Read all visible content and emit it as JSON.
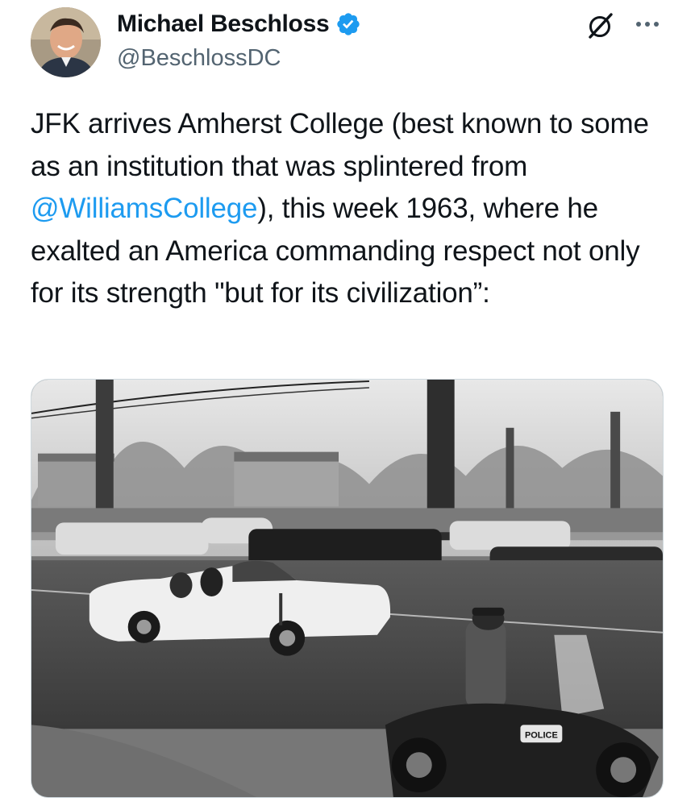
{
  "author": {
    "display_name": "Michael Beschloss",
    "handle": "@BeschlossDC",
    "verified": true
  },
  "icons": {
    "verified": "verified-badge-icon",
    "grok": "grok-icon",
    "more": "more-options-icon"
  },
  "colors": {
    "text": "#0f1419",
    "secondary": "#536471",
    "link": "#1d9bf0"
  },
  "tweet": {
    "text_before": "JFK arrives Amherst College (best known to some as an institution that was splintered from ",
    "mention": "@WilliamsCollege",
    "text_after": "), this week 1963, where he exalted an America commanding respect not only for its strength \"but for its civilization”:"
  },
  "media": {
    "police_badge": "POLICE"
  }
}
